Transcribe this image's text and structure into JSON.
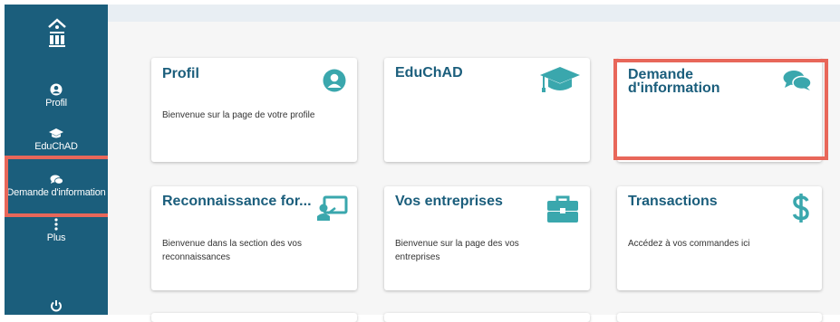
{
  "sidebar": {
    "items": [
      {
        "label": "Profil",
        "icon": "user-circle-icon"
      },
      {
        "label": "EduChAD",
        "icon": "graduation-cap-icon"
      },
      {
        "label": "Demande d'information",
        "icon": "comments-icon"
      },
      {
        "label": "Plus",
        "icon": "more-vertical-icon"
      }
    ],
    "logout_icon": "power-icon",
    "logo_icon": "building-icon"
  },
  "cards": [
    {
      "title": "Profil",
      "description": "Bienvenue sur la page de votre profile",
      "icon": "user-circle-icon"
    },
    {
      "title": "EduChAD",
      "description": "",
      "icon": "graduation-cap-icon"
    },
    {
      "title_line1": "Demande",
      "title_line2": "d'information",
      "description": "",
      "icon": "comments-icon"
    },
    {
      "title": "Reconnaissance for...",
      "description": "Bienvenue dans la section des vos reconnaissances",
      "icon": "presentation-icon"
    },
    {
      "title": "Vos entreprises",
      "description": "Bienvenue sur la page des vos entreprises",
      "icon": "briefcase-icon"
    },
    {
      "title": "Transactions",
      "description": "Accédez à vos commandes ici",
      "icon": "dollar-icon"
    }
  ],
  "colors": {
    "sidebar": "#1b5e7c",
    "accent_icon": "#3aa7ad",
    "highlight": "#e8675a",
    "title": "#1b5e7c"
  }
}
